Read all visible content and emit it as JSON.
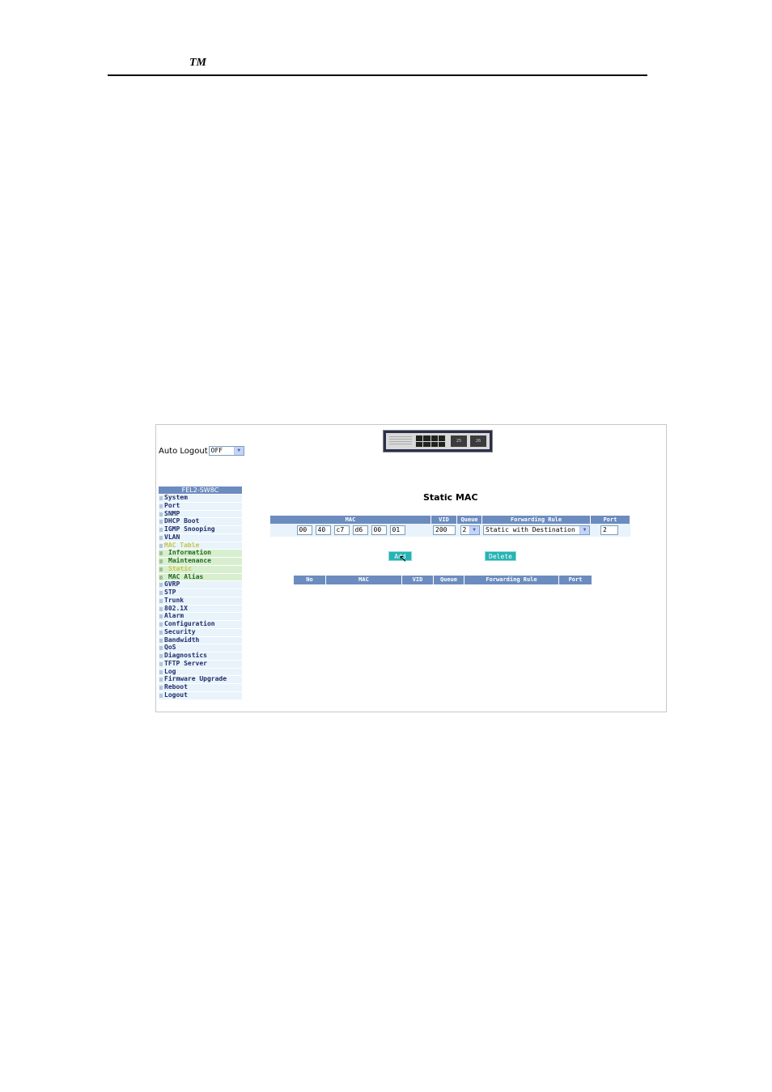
{
  "document": {
    "header_mark": "TM"
  },
  "auto_logout": {
    "label": "Auto Logout",
    "value": "OFF"
  },
  "menu": {
    "title": "FEL2-SW8C",
    "items": [
      {
        "label": "System",
        "level": 0
      },
      {
        "label": "Port",
        "level": 0
      },
      {
        "label": "SNMP",
        "level": 0
      },
      {
        "label": "DHCP Boot",
        "level": 0
      },
      {
        "label": "IGMP Snooping",
        "level": 0
      },
      {
        "label": "VLAN",
        "level": 0
      },
      {
        "label": "MAC Table",
        "level": 0,
        "active": true
      },
      {
        "label": "Information",
        "level": 1
      },
      {
        "label": "Maintenance",
        "level": 1
      },
      {
        "label": "Static",
        "level": 1,
        "current": true
      },
      {
        "label": "MAC Alias",
        "level": 1
      },
      {
        "label": "GVRP",
        "level": 0
      },
      {
        "label": "STP",
        "level": 0
      },
      {
        "label": "Trunk",
        "level": 0
      },
      {
        "label": "802.1X",
        "level": 0
      },
      {
        "label": "Alarm",
        "level": 0
      },
      {
        "label": "Configuration",
        "level": 0
      },
      {
        "label": "Security",
        "level": 0
      },
      {
        "label": "Bandwidth",
        "level": 0
      },
      {
        "label": "QoS",
        "level": 0
      },
      {
        "label": "Diagnostics",
        "level": 0
      },
      {
        "label": "TFTP Server",
        "level": 0
      },
      {
        "label": "Log",
        "level": 0
      },
      {
        "label": "Firmware Upgrade",
        "level": 0
      },
      {
        "label": "Reboot",
        "level": 0
      },
      {
        "label": "Logout",
        "level": 0
      }
    ]
  },
  "page": {
    "title": "Static MAC"
  },
  "form": {
    "headers": {
      "mac": "MAC",
      "vid": "VID",
      "queue": "Queue",
      "rule": "Forwarding Rule",
      "port": "Port"
    },
    "mac_octets": [
      "00",
      "40",
      "c7",
      "d6",
      "00",
      "01"
    ],
    "vid": "200",
    "queue": "2",
    "rule": "Static with Destination Drop",
    "port": "2"
  },
  "buttons": {
    "add": "Add",
    "delete": "Delete"
  },
  "list": {
    "headers": {
      "no": "No",
      "mac": "MAC",
      "vid": "VID",
      "queue": "Queue",
      "rule": "Forwarding Rule",
      "port": "Port"
    }
  },
  "device": {
    "fiber_ports": [
      "25",
      "26"
    ]
  },
  "colors": {
    "accent": "#6c8cbf",
    "button": "#27b3b3",
    "menu_active": "#c6c649",
    "submenu_bg": "#d8efcf"
  }
}
